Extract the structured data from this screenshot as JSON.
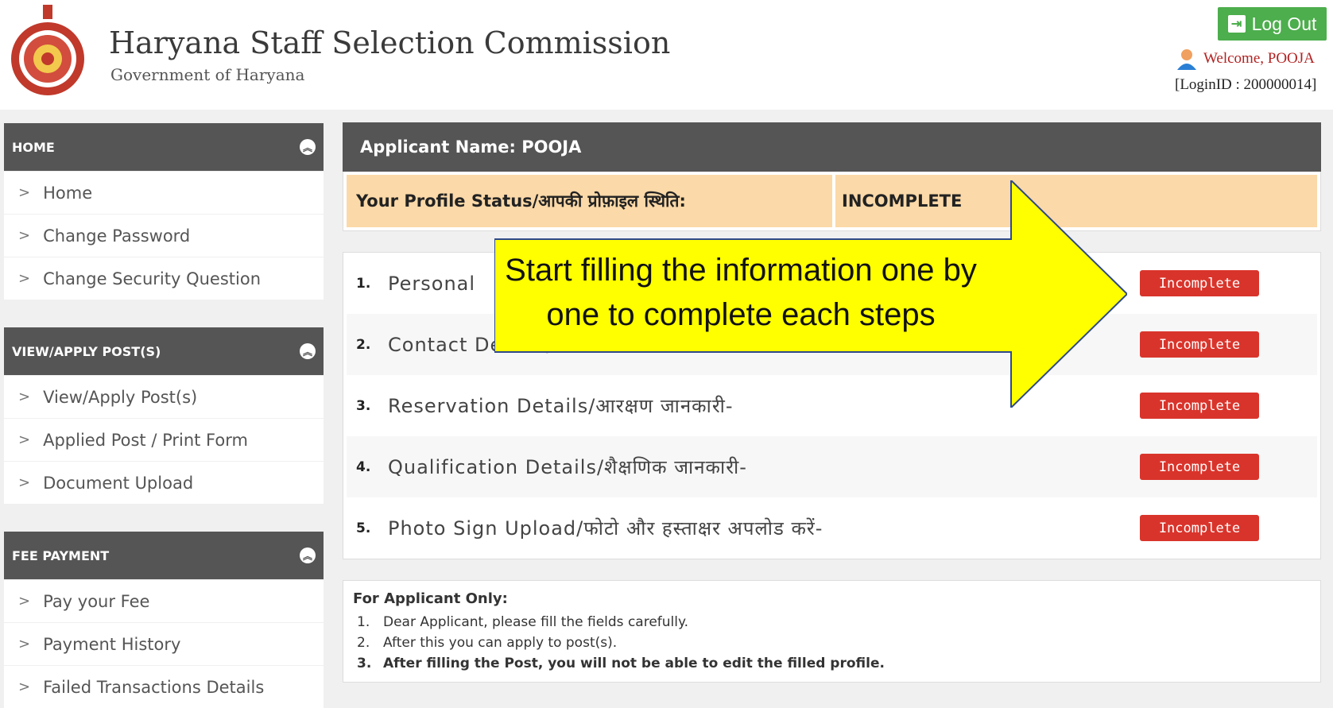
{
  "header": {
    "title": "Haryana Staff Selection Commission",
    "subtitle": "Government of Haryana",
    "logout_label": "Log Out",
    "welcome": "Welcome, POOJA",
    "login_id": "[LoginID : 200000014]"
  },
  "sidebar": {
    "sections": [
      {
        "title": "HOME",
        "items": [
          "Home",
          "Change Password",
          "Change Security Question"
        ]
      },
      {
        "title": "VIEW/APPLY POST(S)",
        "items": [
          "View/Apply Post(s)",
          "Applied Post / Print Form",
          "Document Upload"
        ]
      },
      {
        "title": "FEE PAYMENT",
        "items": [
          "Pay your Fee",
          "Payment History",
          "Failed Transactions Details"
        ]
      }
    ]
  },
  "main": {
    "applicant_label": "Applicant Name: POOJA",
    "status_label": "Your Profile Status/आपकी प्रोफ़ाइल स्थिति:",
    "status_value": "INCOMPLETE",
    "steps": [
      {
        "num": "1.",
        "label": "Personal",
        "status": "Incomplete"
      },
      {
        "num": "2.",
        "label": "Contact Details/संपर्क जानकारी-",
        "status": "Incomplete"
      },
      {
        "num": "3.",
        "label": "Reservation Details/आरक्षण जानकारी-",
        "status": "Incomplete"
      },
      {
        "num": "4.",
        "label": "Qualification Details/शैक्षणिक जानकारी-",
        "status": "Incomplete"
      },
      {
        "num": "5.",
        "label": "Photo Sign Upload/फोटो और हस्ताक्षर अपलोड करें-",
        "status": "Incomplete"
      }
    ],
    "notes": {
      "title": "For Applicant Only:",
      "items": [
        {
          "num": "1.",
          "text": "Dear Applicant, please fill the fields carefully."
        },
        {
          "num": "2.",
          "text": "After this you can apply to post(s)."
        },
        {
          "num": "3.",
          "text": "After filling the Post, you will not be able to edit the filled profile."
        }
      ]
    }
  },
  "callout": {
    "text": "Start filling the information one by one to complete each steps",
    "color": "#ffff00"
  }
}
